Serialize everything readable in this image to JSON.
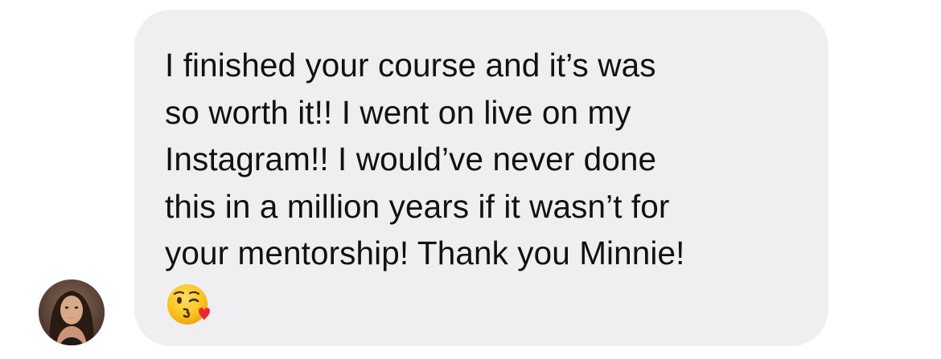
{
  "message": {
    "lines": [
      "I finished your course and it’s was",
      "so worth it!! I went on live on my",
      "Instagram!! I would’ve never done",
      "this in a million years if it wasn’t for",
      "your mentorship! Thank you Minnie!"
    ],
    "emoji": "kissing-face-with-heart-emoji"
  },
  "avatar": {
    "icon": "user-profile-photo"
  },
  "colors": {
    "bubble_background": "#efeff1",
    "text": "#111111",
    "page_background": "#ffffff"
  }
}
